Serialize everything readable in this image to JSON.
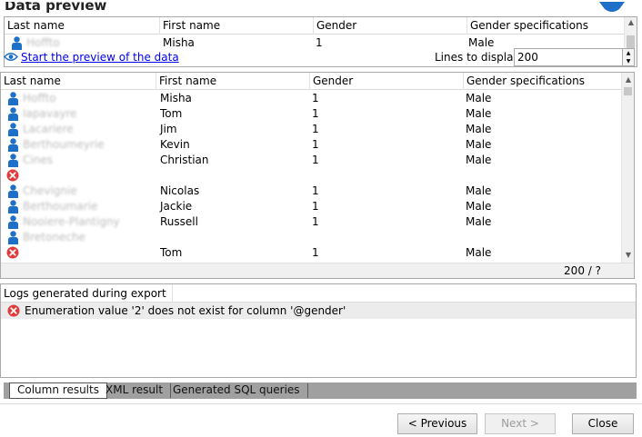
{
  "title": "Data preview",
  "columns": [
    "Last name",
    "First name",
    "Gender",
    "Gender specifications"
  ],
  "preview_row": {
    "last": "Hoffto",
    "first": "Misha",
    "gender": "1",
    "spec": "Male"
  },
  "preview_link": "Start the preview of the data",
  "lines_label": "Lines to display:",
  "lines_value": "200",
  "rows": [
    {
      "icon": "person",
      "last": "Hoffto",
      "first": "Misha",
      "gender": "1",
      "spec": "Male"
    },
    {
      "icon": "person",
      "last": "Iapavayre",
      "first": "Tom",
      "gender": "1",
      "spec": "Male"
    },
    {
      "icon": "person",
      "last": "Lacariere",
      "first": "Jim",
      "gender": "1",
      "spec": "Male"
    },
    {
      "icon": "person",
      "last": "Berthoumeyrie",
      "first": "Kevin",
      "gender": "1",
      "spec": "Male"
    },
    {
      "icon": "person",
      "last": "Cines",
      "first": "Christian",
      "gender": "1",
      "spec": "Male"
    },
    {
      "icon": "error",
      "last": "",
      "first": "",
      "gender": "",
      "spec": ""
    },
    {
      "icon": "person",
      "last": "Chevignie",
      "first": "Nicolas",
      "gender": "1",
      "spec": "Male"
    },
    {
      "icon": "person",
      "last": "Berthoumarie",
      "first": "Jackie",
      "gender": "1",
      "spec": "Male"
    },
    {
      "icon": "person",
      "last": "Nooiere-Plantigny",
      "first": "Russell",
      "gender": "1",
      "spec": "Male"
    },
    {
      "icon": "person",
      "last": "Bretoneche",
      "first": "",
      "gender": "",
      "spec": ""
    },
    {
      "icon": "error",
      "last": "",
      "first": "Tom",
      "gender": "1",
      "spec": "Male"
    }
  ],
  "count_text": "200 / ?",
  "logs_header": "Logs generated during export",
  "log_message": "Enumeration value '2' does not exist for column '@gender'",
  "tabs": [
    "Column results",
    "XML result",
    "Generated SQL queries"
  ],
  "buttons": {
    "previous": "< Previous",
    "next": "Next >",
    "close": "Close"
  },
  "colors": {
    "accent": "#1e6fc8",
    "error": "#e03c3c",
    "tab_bar": "#a0a0a0"
  }
}
